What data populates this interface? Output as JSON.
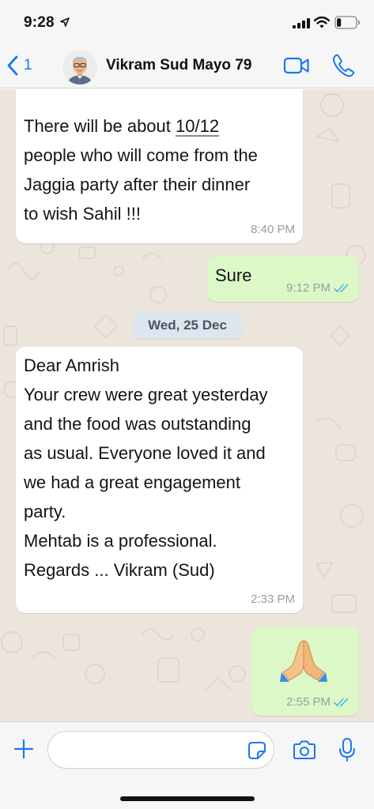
{
  "status_bar": {
    "time": "9:28"
  },
  "header": {
    "back_count": "1",
    "contact_name": "Vikram Sud Mayo 79"
  },
  "messages": [
    {
      "direction": "incoming",
      "text_before": "There will be about ",
      "text_underlined": "10/12",
      "text_after": "\npeople who will come from the\nJaggia party after their dinner\nto wish Sahil !!!",
      "time": "8:40 PM"
    },
    {
      "direction": "outgoing",
      "text": "Sure",
      "time": "9:12 PM",
      "status": "read"
    },
    {
      "direction": "incoming",
      "text": "Dear Amrish\nYour crew were great yesterday\nand the food was outstanding\nas usual. Everyone loved it and\nwe had a great engagement\nparty.\nMehtab is a professional.\nRegards ... Vikram (Sud)",
      "time": "2:33 PM"
    },
    {
      "direction": "outgoing",
      "emoji": "folded-hands",
      "time": "2:55 PM",
      "status": "read"
    }
  ],
  "date_separator": "Wed, 25 Dec",
  "composer": {
    "placeholder": ""
  },
  "colors": {
    "accent": "#1a78f2",
    "outgoing_bubble": "#dcf8c6",
    "incoming_bubble": "#ffffff",
    "chat_background": "#ece5dc",
    "read_ticks": "#4fb6ec"
  },
  "icons": {
    "status": [
      "location-arrow-icon",
      "signal-icon",
      "wifi-icon",
      "battery-icon"
    ],
    "header": [
      "back-chevron-icon",
      "video-call-icon",
      "phone-icon"
    ],
    "composer": [
      "plus-icon",
      "sticker-icon",
      "camera-icon",
      "microphone-icon"
    ]
  }
}
